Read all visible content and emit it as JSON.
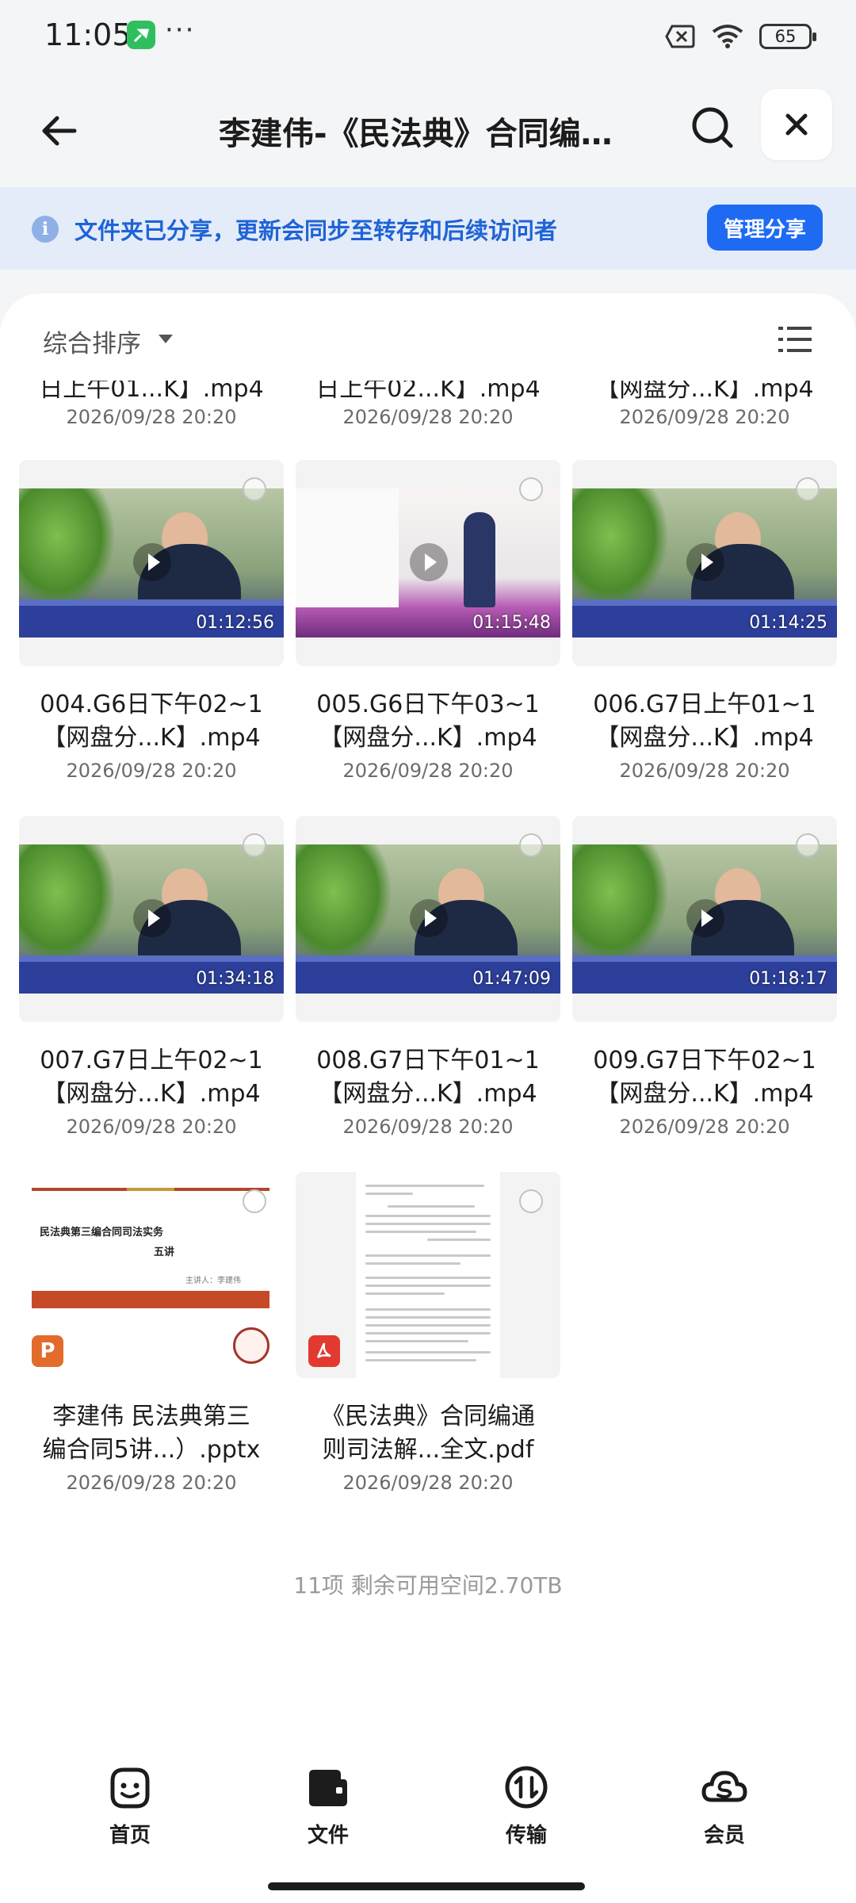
{
  "status_bar": {
    "time": "11:05",
    "dots": "···",
    "battery": "65"
  },
  "header": {
    "title": "李建伟-《民法典》合同编…",
    "back_icon": "arrow-left-icon",
    "search_icon": "search-icon",
    "close_icon": "close-icon"
  },
  "share_banner": {
    "text": "文件夹已分享，更新会同步至转存和后续访问者",
    "button": "管理分享"
  },
  "sort_bar": {
    "label": "综合排序"
  },
  "partial_row": [
    {
      "name": "日上午01...K】.mp4",
      "date": "2026/09/28 20:20"
    },
    {
      "name": "日上午02...K】.mp4",
      "date": "2026/09/28 20:20"
    },
    {
      "name": "【网盘分...K】.mp4",
      "date": "2026/09/28 20:20"
    }
  ],
  "files": [
    {
      "line1": "004.G6日下午02~1",
      "line2": "【网盘分...K】.mp4",
      "date": "2026/09/28 20:20",
      "duration": "01:12:56",
      "kind": "video"
    },
    {
      "line1": "005.G6日下午03~1",
      "line2": "【网盘分...K】.mp4",
      "date": "2026/09/28 20:20",
      "duration": "01:15:48",
      "kind": "stage"
    },
    {
      "line1": "006.G7日上午01~1",
      "line2": "【网盘分...K】.mp4",
      "date": "2026/09/28 20:20",
      "duration": "01:14:25",
      "kind": "video"
    },
    {
      "line1": "007.G7日上午02~1",
      "line2": "【网盘分...K】.mp4",
      "date": "2026/09/28 20:20",
      "duration": "01:34:18",
      "kind": "video"
    },
    {
      "line1": "008.G7日下午01~1",
      "line2": "【网盘分...K】.mp4",
      "date": "2026/09/28 20:20",
      "duration": "01:47:09",
      "kind": "video"
    },
    {
      "line1": "009.G7日下午02~1",
      "line2": "【网盘分...K】.mp4",
      "date": "2026/09/28 20:20",
      "duration": "01:18:17",
      "kind": "video"
    },
    {
      "line1": "李建伟 民法典第三",
      "line2": "编合同5讲...）.pptx",
      "date": "2026/09/28 20:20",
      "kind": "pptx",
      "preview": {
        "title": "民法典第三编合同司法实务",
        "subtitle": "五讲",
        "speaker": "主讲人：李建伟",
        "badge": "P"
      }
    },
    {
      "line1": "《民法典》合同编通",
      "line2": "则司法解...全文.pdf",
      "date": "2026/09/28 20:20",
      "kind": "pdf"
    }
  ],
  "footer": "11项 剩余可用空间2.70TB",
  "nav": [
    {
      "label": "首页",
      "icon": "smiley-home-icon"
    },
    {
      "label": "文件",
      "icon": "folder-icon"
    },
    {
      "label": "传输",
      "icon": "transfer-icon"
    },
    {
      "label": "会员",
      "icon": "vip-cloud-icon"
    }
  ]
}
